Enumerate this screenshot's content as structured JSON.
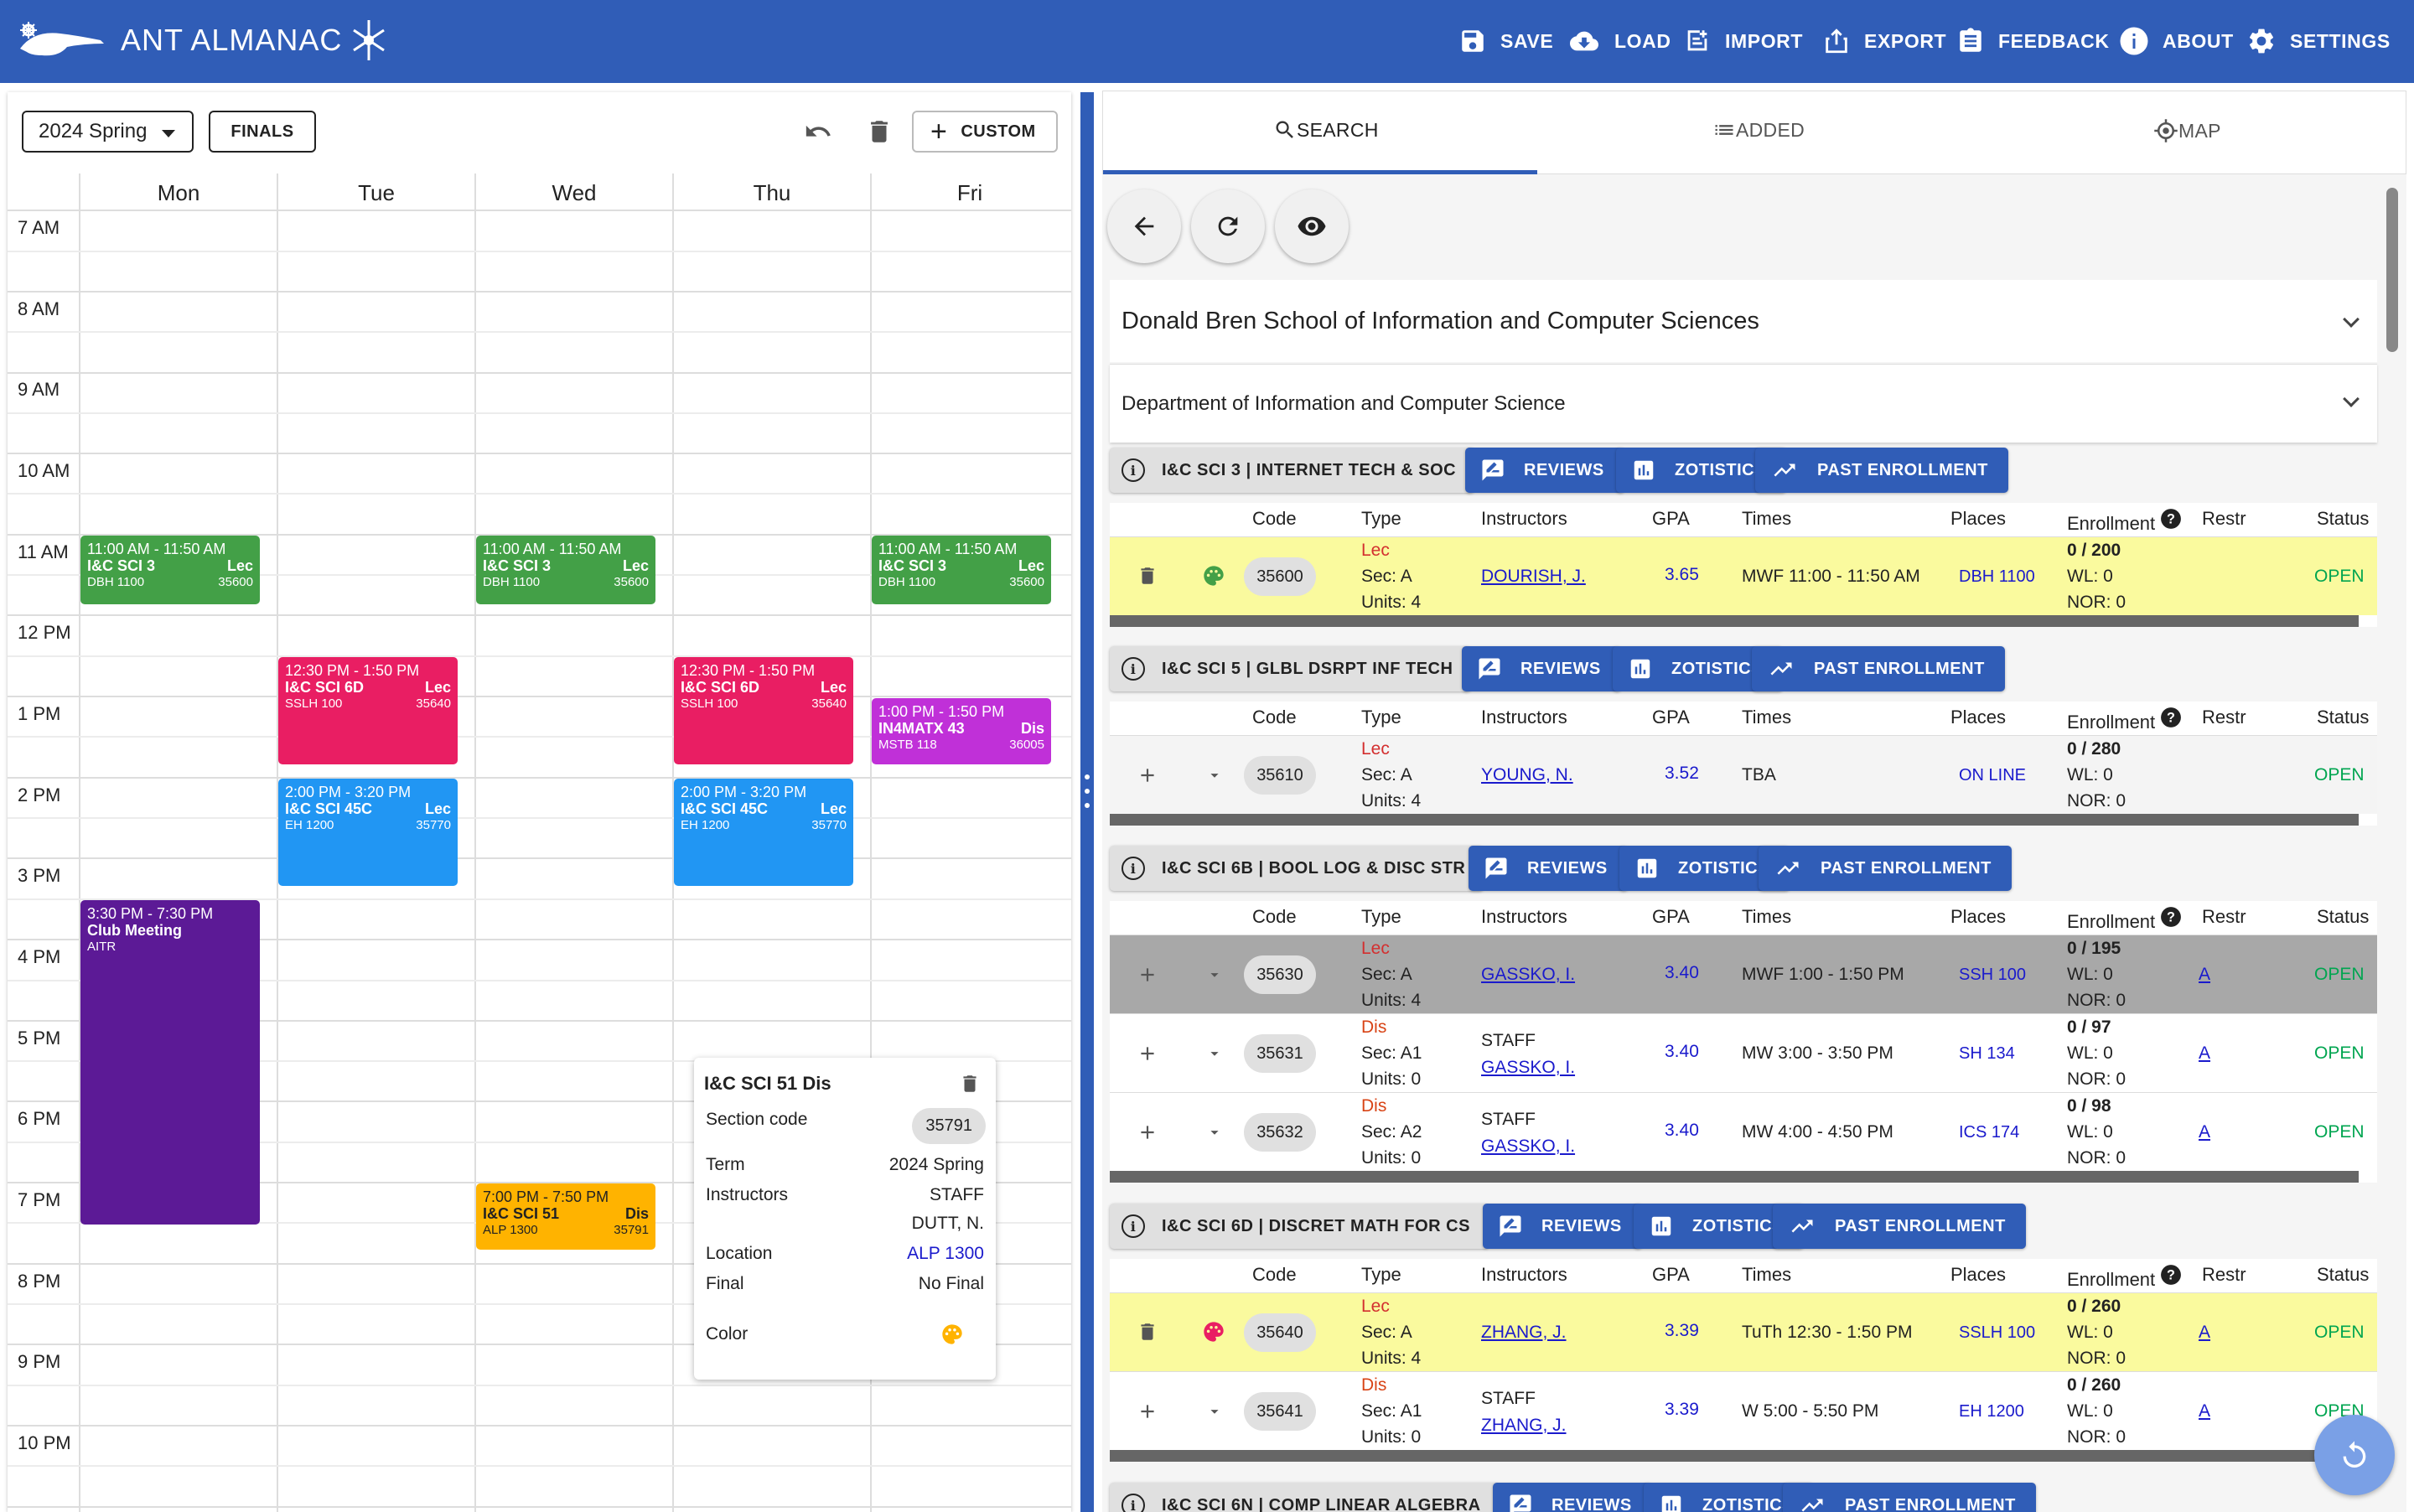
{
  "header": {
    "logo_text": "ANT ALMANAC",
    "nav": {
      "save": "SAVE",
      "load": "LOAD",
      "import": "IMPORT",
      "export": "EXPORT",
      "feedback": "FEEDBACK",
      "about": "ABOUT",
      "settings": "SETTINGS"
    }
  },
  "calendar": {
    "term": "2024 Spring",
    "finals_label": "FINALS",
    "custom_label": "CUSTOM",
    "days": [
      "Mon",
      "Tue",
      "Wed",
      "Thu",
      "Fri"
    ],
    "times": [
      "7 AM",
      "8 AM",
      "9 AM",
      "10 AM",
      "11 AM",
      "12 PM",
      "1 PM",
      "2 PM",
      "3 PM",
      "4 PM",
      "5 PM",
      "6 PM",
      "7 PM",
      "8 PM",
      "9 PM",
      "10 PM"
    ],
    "events": {
      "e1": {
        "time": "11:00 AM - 11:50 AM",
        "title": "I&C SCI 3",
        "type": "Lec",
        "loc": "DBH 1100",
        "code": "35600"
      },
      "e2": {
        "time": "11:00 AM - 11:50 AM",
        "title": "I&C SCI 3",
        "type": "Lec",
        "loc": "DBH 1100",
        "code": "35600"
      },
      "e3": {
        "time": "11:00 AM - 11:50 AM",
        "title": "I&C SCI 3",
        "type": "Lec",
        "loc": "DBH 1100",
        "code": "35600"
      },
      "e4": {
        "time": "12:30 PM - 1:50 PM",
        "title": "I&C SCI 6D",
        "type": "Lec",
        "loc": "SSLH 100",
        "code": "35640"
      },
      "e5": {
        "time": "12:30 PM - 1:50 PM",
        "title": "I&C SCI 6D",
        "type": "Lec",
        "loc": "SSLH 100",
        "code": "35640"
      },
      "e6": {
        "time": "1:00 PM - 1:50 PM",
        "title": "IN4MATX 43",
        "type": "Dis",
        "loc": "MSTB 118",
        "code": "36005"
      },
      "e7": {
        "time": "2:00 PM - 3:20 PM",
        "title": "I&C SCI 45C",
        "type": "Lec",
        "loc": "EH 1200",
        "code": "35770"
      },
      "e8": {
        "time": "2:00 PM - 3:20 PM",
        "title": "I&C SCI 45C",
        "type": "Lec",
        "loc": "EH 1200",
        "code": "35770"
      },
      "e9": {
        "time": "3:30 PM - 7:30 PM",
        "title": "Club Meeting",
        "loc": "AITR"
      },
      "e10": {
        "time": "7:00 PM - 7:50 PM",
        "title": "I&C SCI 51",
        "type": "Dis",
        "loc": "ALP 1300",
        "code": "35791"
      }
    },
    "popover": {
      "title": "I&C SCI 51 Dis",
      "section_code_label": "Section code",
      "section_code": "35791",
      "term_label": "Term",
      "term": "2024 Spring",
      "instructors_label": "Instructors",
      "instructor1": "STAFF",
      "instructor2": "DUTT, N.",
      "location_label": "Location",
      "location": "ALP 1300",
      "final_label": "Final",
      "final": "No Final",
      "color_label": "Color"
    }
  },
  "right": {
    "tabs": {
      "search": "SEARCH",
      "added": "ADDED",
      "map": "MAP"
    },
    "school": "Donald Bren School of Information and Computer Sciences",
    "department": "Department of Information and Computer Science",
    "buttons": {
      "reviews": "REVIEWS",
      "zotistics": "ZOTISTICS",
      "past": "PAST ENROLLMENT"
    },
    "columns": {
      "code": "Code",
      "type": "Type",
      "instructors": "Instructors",
      "gpa": "GPA",
      "times": "Times",
      "places": "Places",
      "enrollment": "Enrollment",
      "restr": "Restr",
      "status": "Status"
    },
    "courses": [
      {
        "title": "I&C SCI 3 | INTERNET TECH & SOC",
        "sections": [
          {
            "code": "35600",
            "type": "Lec",
            "sec": "Sec: A",
            "units": "Units: 4",
            "instr1": "",
            "instr2": "DOURISH, J.",
            "gpa": "3.65",
            "times": "MWF 11:00 - 11:50 AM",
            "place": "DBH 1100",
            "enr": "0 / 200",
            "wl": "WL: 0",
            "nor": "NOR: 0",
            "restr": "",
            "status": "OPEN"
          }
        ]
      },
      {
        "title": "I&C SCI 5 | GLBL DSRPT INF TECH",
        "sections": [
          {
            "code": "35610",
            "type": "Lec",
            "sec": "Sec: A",
            "units": "Units: 4",
            "instr1": "",
            "instr2": "YOUNG, N.",
            "gpa": "3.52",
            "times": "TBA",
            "place": "ON LINE",
            "enr": "0 / 280",
            "wl": "WL: 0",
            "nor": "NOR: 0",
            "restr": "",
            "status": "OPEN"
          }
        ]
      },
      {
        "title": "I&C SCI 6B | BOOL LOG & DISC STR",
        "sections": [
          {
            "code": "35630",
            "type": "Lec",
            "sec": "Sec: A",
            "units": "Units: 4",
            "instr1": "",
            "instr2": "GASSKO, I.",
            "gpa": "3.40",
            "times": "MWF 1:00 - 1:50 PM",
            "place": "SSH 100",
            "enr": "0 / 195",
            "wl": "WL: 0",
            "nor": "NOR: 0",
            "restr": "A",
            "status": "OPEN"
          },
          {
            "code": "35631",
            "type": "Dis",
            "sec": "Sec: A1",
            "units": "Units: 0",
            "instr1": "STAFF",
            "instr2": "GASSKO, I.",
            "gpa": "3.40",
            "times": "MW 3:00 - 3:50 PM",
            "place": "SH 134",
            "enr": "0 / 97",
            "wl": "WL: 0",
            "nor": "NOR: 0",
            "restr": "A",
            "status": "OPEN"
          },
          {
            "code": "35632",
            "type": "Dis",
            "sec": "Sec: A2",
            "units": "Units: 0",
            "instr1": "STAFF",
            "instr2": "GASSKO, I.",
            "gpa": "3.40",
            "times": "MW 4:00 - 4:50 PM",
            "place": "ICS 174",
            "enr": "0 / 98",
            "wl": "WL: 0",
            "nor": "NOR: 0",
            "restr": "A",
            "status": "OPEN"
          }
        ]
      },
      {
        "title": "I&C SCI 6D | DISCRET MATH FOR CS",
        "sections": [
          {
            "code": "35640",
            "type": "Lec",
            "sec": "Sec: A",
            "units": "Units: 4",
            "instr1": "",
            "instr2": "ZHANG, J.",
            "gpa": "3.39",
            "times": "TuTh 12:30 - 1:50 PM",
            "place": "SSLH 100",
            "enr": "0 / 260",
            "wl": "WL: 0",
            "nor": "NOR: 0",
            "restr": "A",
            "status": "OPEN"
          },
          {
            "code": "35641",
            "type": "Dis",
            "sec": "Sec: A1",
            "units": "Units: 0",
            "instr1": "STAFF",
            "instr2": "ZHANG, J.",
            "gpa": "3.39",
            "times": "W 5:00 - 5:50 PM",
            "place": "EH 1200",
            "enr": "0 / 260",
            "wl": "WL: 0",
            "nor": "NOR: 0",
            "restr": "A",
            "status": "OPEN"
          }
        ]
      },
      {
        "title": "I&C SCI 6N | COMP LINEAR ALGEBRA",
        "sections": []
      }
    ]
  },
  "colors": {
    "brand": "#305db7",
    "green": "#43a047",
    "pink": "#e91e63",
    "magenta": "#c030d8",
    "blue": "#2196f3",
    "purple": "#5c1a96",
    "amber": "#ffb300",
    "added_row": "#fafa9e",
    "selected_row": "#a8a8a8"
  }
}
